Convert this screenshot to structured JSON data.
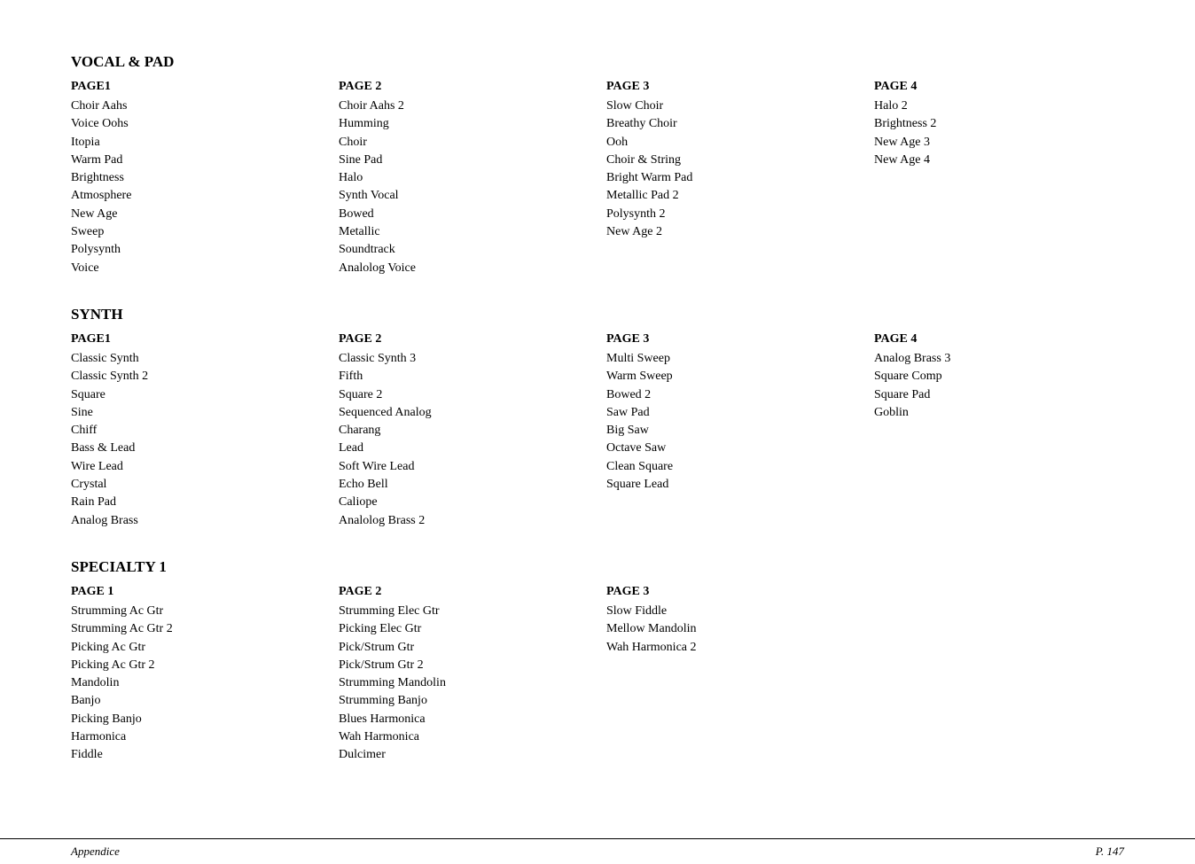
{
  "sections": [
    {
      "id": "vocal-pad",
      "title": "VOCAL & PAD",
      "columns": [
        {
          "page": "PAGE1",
          "items": [
            "Choir Aahs",
            "Voice Oohs",
            "Itopia",
            "Warm Pad",
            "Brightness",
            "Atmosphere",
            "New Age",
            "Sweep",
            "Polysynth",
            "Voice"
          ]
        },
        {
          "page": "PAGE 2",
          "items": [
            "Choir Aahs 2",
            "Humming",
            "Choir",
            "Sine Pad",
            "Halo",
            "Synth Vocal",
            "Bowed",
            "Metallic",
            "Soundtrack",
            "Analolog Voice"
          ]
        },
        {
          "page": "PAGE 3",
          "items": [
            "Slow Choir",
            "Breathy Choir",
            "Ooh",
            "Choir & String",
            "Bright Warm Pad",
            "Metallic Pad 2",
            "Polysynth 2",
            "New Age 2"
          ]
        },
        {
          "page": "PAGE 4",
          "items": [
            "Halo 2",
            "Brightness 2",
            "New Age 3",
            "New Age 4"
          ]
        }
      ]
    },
    {
      "id": "synth",
      "title": "SYNTH",
      "columns": [
        {
          "page": "PAGE1",
          "items": [
            "Classic Synth",
            "Classic Synth 2",
            "Square",
            "Sine",
            "Chiff",
            "Bass & Lead",
            "Wire Lead",
            "Crystal",
            "Rain Pad",
            "Analog Brass"
          ]
        },
        {
          "page": "PAGE 2",
          "items": [
            "Classic Synth 3",
            "Fifth",
            "Square 2",
            "Sequenced Analog",
            "Charang",
            "Lead",
            "Soft Wire Lead",
            "Echo Bell",
            "Caliope",
            "Analolog Brass 2"
          ]
        },
        {
          "page": "PAGE 3",
          "items": [
            "Multi Sweep",
            "Warm Sweep",
            "Bowed 2",
            "Saw Pad",
            "Big Saw",
            "Octave Saw",
            "Clean Square",
            "Square Lead"
          ]
        },
        {
          "page": "PAGE 4",
          "items": [
            "Analog Brass 3",
            "Square Comp",
            "Square Pad",
            "Goblin"
          ]
        }
      ]
    },
    {
      "id": "specialty1",
      "title": "SPECIALTY 1",
      "columns": [
        {
          "page": "PAGE 1",
          "items": [
            "Strumming Ac Gtr",
            "Strumming Ac Gtr 2",
            "Picking Ac Gtr",
            "Picking Ac Gtr 2",
            "Mandolin",
            "Banjo",
            "Picking Banjo",
            "Harmonica",
            "Fiddle"
          ]
        },
        {
          "page": "PAGE 2",
          "items": [
            "Strumming Elec Gtr",
            "Picking Elec Gtr",
            "Pick/Strum Gtr",
            "Pick/Strum Gtr 2",
            "Strumming Mandolin",
            "Strumming Banjo",
            "Blues Harmonica",
            "Wah Harmonica",
            "Dulcimer"
          ]
        },
        {
          "page": "PAGE 3",
          "items": [
            "Slow Fiddle",
            "Mellow Mandolin",
            "Wah Harmonica 2"
          ]
        },
        {
          "page": "",
          "items": []
        }
      ]
    }
  ],
  "footer": {
    "left": "Appendice",
    "right": "P. 147"
  }
}
